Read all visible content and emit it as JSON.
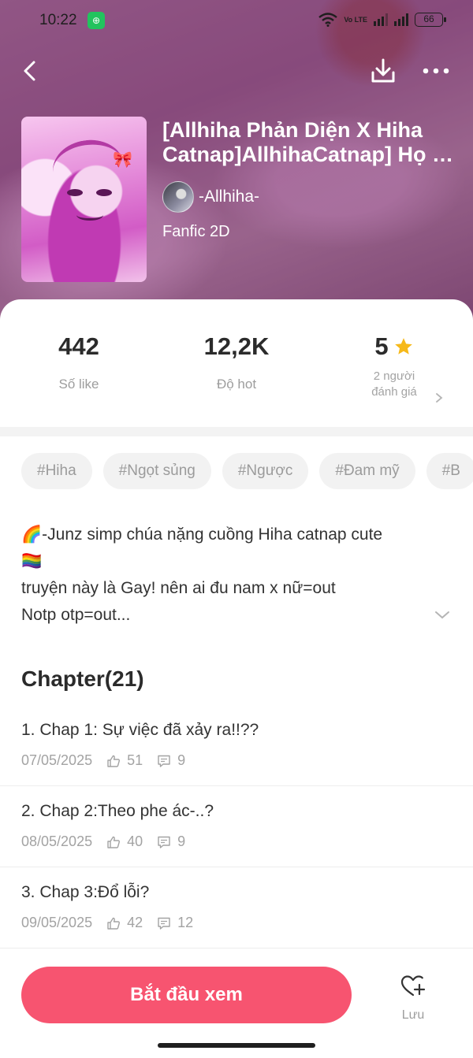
{
  "status_bar": {
    "time": "10:22",
    "volte": "Vo LTE",
    "battery": "66"
  },
  "story": {
    "title": "[Allhiha Phản Diện X Hiha Catnap]AllhihaCatnap] Họ …",
    "author": "-Allhiha-",
    "genre": "Fanfic 2D"
  },
  "stats": {
    "likes_value": "442",
    "likes_label": "Số like",
    "hot_value": "12,2K",
    "hot_label": "Độ hot",
    "rating_value": "5",
    "rating_label_line1": "2 người",
    "rating_label_line2": "đánh giá"
  },
  "tags": [
    "#Hiha",
    "#Ngọt sủng",
    "#Ngược",
    "#Đam mỹ",
    "#B"
  ],
  "description": {
    "line1": "🌈-Junz simp chúa nặng cuồng Hiha catnap cute",
    "line2": "🏳️‍🌈",
    "line3": "truyện này là Gay! nên ai đu nam x nữ=out",
    "line4": "Notp otp=out..."
  },
  "chapters": {
    "heading": "Chapter(21)",
    "items": [
      {
        "title": "1. Chap 1: Sự việc đã xảy ra!!??",
        "date": "07/05/2025",
        "likes": "51",
        "comments": "9"
      },
      {
        "title": "2. Chap 2:Theo phe ác-..?",
        "date": "08/05/2025",
        "likes": "40",
        "comments": "9"
      },
      {
        "title": "3. Chap 3:Đổ lỗi?",
        "date": "09/05/2025",
        "likes": "42",
        "comments": "12"
      }
    ]
  },
  "bottom": {
    "start_label": "Bắt đầu xem",
    "save_label": "Lưu"
  },
  "colors": {
    "accent": "#f75470",
    "star": "#f6b91a"
  }
}
